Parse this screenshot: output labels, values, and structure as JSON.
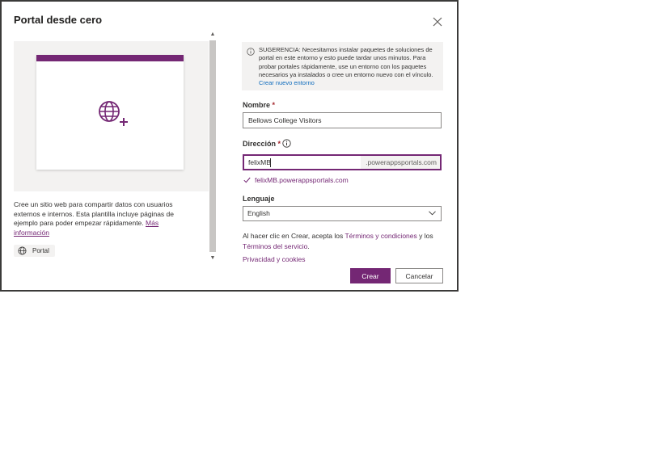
{
  "dialog": {
    "title": "Portal desde cero",
    "close_icon": "close-icon"
  },
  "preview": {
    "accent_color": "#742774",
    "icon": "globe-add-icon",
    "description": "Cree un sitio web para compartir datos con usuarios externos e internos. Esta plantilla incluye páginas de ejemplo para poder empezar rápidamente.",
    "more_info_link": "Más información",
    "tag_label": "Portal",
    "tag_icon": "globe-icon"
  },
  "hint": {
    "icon": "info-icon",
    "text": "SUGERENCIA: Necesitamos instalar paquetes de soluciones de portal en este entorno y esto puede tardar unos minutos. Para probar portales rápidamente, use un entorno con los paquetes necesarios ya instalados o cree un entorno nuevo con el vínculo.",
    "link": "Crear nuevo entorno"
  },
  "form": {
    "name_label": "Nombre",
    "required_mark": "*",
    "name_value": "Bellows College Visitors",
    "address_label": "Dirección",
    "address_value": "felixMB",
    "address_suffix": ".powerappsportals.com",
    "address_validation": "felixMB.powerappsportals.com",
    "language_label": "Lenguaje",
    "language_value": "English"
  },
  "legal": {
    "prefix": "Al hacer clic en Crear, acepta los ",
    "terms_link": "Términos y condiciones",
    "conjunction": " y los ",
    "service_link": "Términos del servicio",
    "suffix": ".",
    "privacy_link": "Privacidad y cookies"
  },
  "actions": {
    "create": "Crear",
    "cancel": "Cancelar"
  },
  "colors": {
    "brand": "#742774",
    "link_blue": "#0f6cbd",
    "panel_bg": "#f3f2f1"
  }
}
